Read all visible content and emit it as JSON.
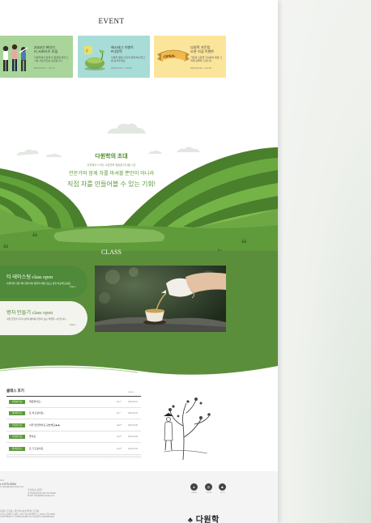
{
  "event": {
    "title": "EVENT",
    "cards": [
      {
        "title": "2024년 위빈기\n티 서포터즈 모집",
        "desc": "다원학에서 함께 차 문화를 알리고 나눌 서포터즈를 모집합니다.",
        "date": "2024.03.01 ~ 03.31",
        "bg": "#a9d59b"
      },
      {
        "title": "해시태그 이벤트\n#다원학",
        "desc": "다원학 체험 사진과 함께 해시태그를 남겨주세요.",
        "date": "2024.03.01 ~ 03.31",
        "bg": "#a8dcd6"
      },
      {
        "title": "다원학 가든점\n오픈 기념 이벤트",
        "desc": "가든점 오픈을 기념하여 방문 고객께 선물을 드립니다.",
        "date": "2024.03.01 ~ 03.31",
        "bg": "#fbe59b",
        "ribbon": "-OPEN-"
      }
    ]
  },
  "invitation": {
    "title": "다원학의 초대",
    "subtitle": "자연에서 느끼는 오감만족 힐링을 만나볼 시간",
    "line1": "전문가와 함께 차를 마셔볼 뿐만이 아니라",
    "line2": "직접 차를 만들어볼 수 있는 기회!"
  },
  "class": {
    "title": "CLASS",
    "items": [
      {
        "name": "티 테이스팅 class open",
        "desc": "다원학의 전문가와 함께 여러 종류의 차를 맛보고 향을 비교해 보세요.",
        "more": "more +"
      },
      {
        "name": "병차 만들기 class open",
        "desc": "직접 찻잎을 다져 나만의 병차를 만들어 보는 특별한 시간입니다.",
        "more": "more +"
      }
    ]
  },
  "reviews": {
    "title": "클래스 후기",
    "more": "more +",
    "items": [
      {
        "badge": "티테이스팅",
        "text": "재밌었어요~",
        "author": "kim**",
        "date": "2024.03.12"
      },
      {
        "badge": "병차만들기",
        "text": "또 하고싶어요~",
        "author": "lee**",
        "date": "2024.03.10"
      },
      {
        "badge": "티테이스팅",
        "text": "너무 맛있었어요 강습해요★★",
        "author": "park**",
        "date": "2024.03.08"
      },
      {
        "badge": "티테이스팅",
        "text": "좋아요",
        "author": "choi**",
        "date": "2024.03.05"
      },
      {
        "badge": "병차만들기",
        "text": "또 가고싶어요",
        "author": "jung**",
        "date": "2024.03.02"
      }
    ]
  },
  "footer": {
    "info": [
      "com",
      "c.1575-5084",
      "contact@dawonhak.com"
    ],
    "info2": [
      "주식회사 다원학",
      "사업자등록번호 000-00-00000",
      "Email. info@dawonhak.com"
    ],
    "info3": [
      "대표자 홍길동 | 개인정보보호책임자 홍길동",
      "경기도 양평군 다원로 123 | 통신판매업신고 2024-경기-0000",
      "COPYRIGHT © DAWONHAK ALL RIGHTS RESERVED."
    ],
    "sns": [
      "KAKAO",
      "INSTA",
      "BLOG"
    ],
    "logo": "다원학"
  }
}
